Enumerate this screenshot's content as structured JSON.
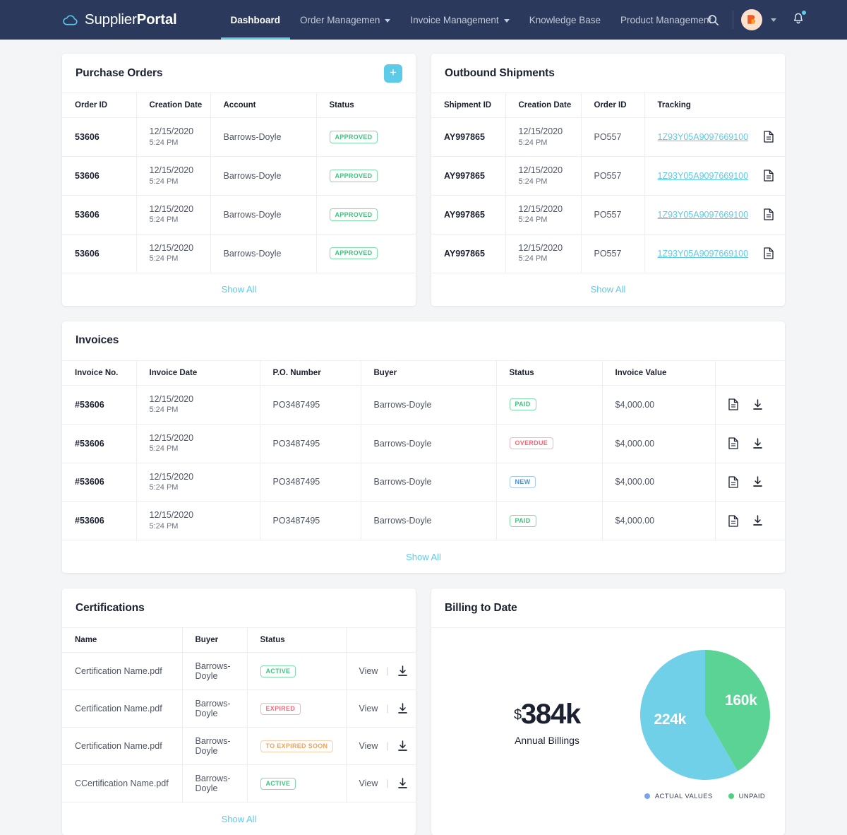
{
  "navbar": {
    "brand_light": "Supplier",
    "brand_bold": "Portal",
    "logo_icon": "cloud-icon",
    "links": [
      {
        "label": "Dashboard",
        "active": true,
        "caret": false
      },
      {
        "label": "Order Managemen",
        "active": false,
        "caret": true
      },
      {
        "label": "Invoice Management",
        "active": false,
        "caret": true
      },
      {
        "label": "Knowledge Base",
        "active": false,
        "caret": false
      },
      {
        "label": "Product Management",
        "active": false,
        "caret": false
      }
    ],
    "search_icon": "search-icon",
    "avatar_icon": "user-avatar",
    "chevron_icon": "chevron-down-icon",
    "bell_icon": "notification-bell-icon",
    "accent_color": "#5bcbe8",
    "nav_background": "#2b3a5c"
  },
  "purchase_orders": {
    "title": "Purchase Orders",
    "add_label": "+",
    "columns": [
      "Order ID",
      "Creation Date",
      "Account",
      "Status"
    ],
    "rows": [
      {
        "order_id": "53606",
        "date": "12/15/2020",
        "time": "5:24 PM",
        "account": "Barrows-Doyle",
        "status": "APPROVED",
        "status_tone": "green"
      },
      {
        "order_id": "53606",
        "date": "12/15/2020",
        "time": "5:24 PM",
        "account": "Barrows-Doyle",
        "status": "APPROVED",
        "status_tone": "green"
      },
      {
        "order_id": "53606",
        "date": "12/15/2020",
        "time": "5:24 PM",
        "account": "Barrows-Doyle",
        "status": "APPROVED",
        "status_tone": "green"
      },
      {
        "order_id": "53606",
        "date": "12/15/2020",
        "time": "5:24 PM",
        "account": "Barrows-Doyle",
        "status": "APPROVED",
        "status_tone": "green"
      }
    ],
    "show_all": "Show All"
  },
  "outbound_shipments": {
    "title": "Outbound Shipments",
    "columns": [
      "Shipment ID",
      "Creation Date",
      "Order ID",
      "Tracking",
      ""
    ],
    "rows": [
      {
        "shipment_id": "AY997865",
        "date": "12/15/2020",
        "time": "5:24 PM",
        "order_id": "PO557",
        "tracking": "1Z93Y05A9097669100",
        "doc_icon": "document-icon"
      },
      {
        "shipment_id": "AY997865",
        "date": "12/15/2020",
        "time": "5:24 PM",
        "order_id": "PO557",
        "tracking": "1Z93Y05A9097669100",
        "doc_icon": "document-icon"
      },
      {
        "shipment_id": "AY997865",
        "date": "12/15/2020",
        "time": "5:24 PM",
        "order_id": "PO557",
        "tracking": "1Z93Y05A9097669100",
        "doc_icon": "document-icon"
      },
      {
        "shipment_id": "AY997865",
        "date": "12/15/2020",
        "time": "5:24 PM",
        "order_id": "PO557",
        "tracking": "1Z93Y05A9097669100",
        "doc_icon": "document-icon"
      }
    ],
    "show_all": "Show All"
  },
  "invoices": {
    "title": "Invoices",
    "columns": [
      "Invoice No.",
      "Invoice Date",
      "P.O. Number",
      "Buyer",
      "Status",
      "Invoice Value",
      ""
    ],
    "rows": [
      {
        "invoice_no": "#53606",
        "date": "12/15/2020",
        "time": "5:24 PM",
        "po_number": "PO3487495",
        "buyer": "Barrows-Doyle",
        "status": "PAID",
        "status_tone": "green",
        "value": "$4,000.00"
      },
      {
        "invoice_no": "#53606",
        "date": "12/15/2020",
        "time": "5:24 PM",
        "po_number": "PO3487495",
        "buyer": "Barrows-Doyle",
        "status": "OVERDUE",
        "status_tone": "red",
        "value": "$4,000.00"
      },
      {
        "invoice_no": "#53606",
        "date": "12/15/2020",
        "time": "5:24 PM",
        "po_number": "PO3487495",
        "buyer": "Barrows-Doyle",
        "status": "NEW",
        "status_tone": "blue",
        "value": "$4,000.00"
      },
      {
        "invoice_no": "#53606",
        "date": "12/15/2020",
        "time": "5:24 PM",
        "po_number": "PO3487495",
        "buyer": "Barrows-Doyle",
        "status": "PAID",
        "status_tone": "green",
        "value": "$4,000.00"
      }
    ],
    "doc_icon": "document-icon",
    "download_icon": "download-icon",
    "show_all": "Show All"
  },
  "certifications": {
    "title": "Certifications",
    "columns": [
      "Name",
      "Buyer",
      "Status",
      ""
    ],
    "view_label": "View",
    "download_icon": "download-icon",
    "rows": [
      {
        "name": "Certification Name.pdf",
        "buyer": "Barrows-Doyle",
        "status": "ACTIVE",
        "status_tone": "green"
      },
      {
        "name": "Certification Name.pdf",
        "buyer": "Barrows-Doyle",
        "status": "EXPIRED",
        "status_tone": "red"
      },
      {
        "name": "Certification Name.pdf",
        "buyer": "Barrows-Doyle",
        "status": "TO EXPIRED SOON",
        "status_tone": "orange"
      },
      {
        "name": "CCertification Name.pdf",
        "buyer": "Barrows-Doyle",
        "status": "ACTIVE",
        "status_tone": "green"
      }
    ],
    "show_all": "Show All"
  },
  "billing": {
    "title": "Billing to Date",
    "currency_symbol": "$",
    "total": "384k",
    "total_label": "Annual Billings"
  },
  "chart_data": {
    "type": "pie",
    "title": "Billing to Date",
    "labels": [
      "ACTUAL VALUES",
      "UNPAID"
    ],
    "values": [
      224,
      160
    ],
    "value_labels": [
      "224k",
      "160k"
    ],
    "colors": [
      "#6fd0e8",
      "#5ad395"
    ],
    "legend_colors": [
      "#7aa5ea",
      "#4dd07f"
    ],
    "legend_position": "bottom",
    "units": "thousands of dollars",
    "total": 384,
    "start_angle_deg": 0,
    "annotations": [
      "$384k Annual Billings"
    ]
  }
}
